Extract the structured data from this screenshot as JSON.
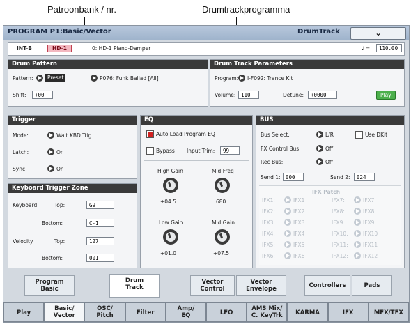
{
  "callouts": {
    "left": "Patroonbank / nr.",
    "right": "Drumtrackprogramma"
  },
  "header": {
    "title": "PROGRAM P1:Basic/Vector",
    "page": "DrumTrack",
    "menu_icon": "chevron-down-icon"
  },
  "program_bar": {
    "bank": "INT-B",
    "number": "HD-1",
    "name": "0: HD-1 Piano-Damper",
    "tempo_symbol": "♩ =",
    "tempo": "110.00"
  },
  "drum_pattern": {
    "title": "Drum Pattern",
    "pattern_label": "Pattern:",
    "pattern_source": "Preset",
    "pattern_value": "P076: Funk Ballad [All]",
    "shift_label": "Shift:",
    "shift_value": "+00"
  },
  "drum_params": {
    "title": "Drum Track Parameters",
    "program_label": "Program:",
    "program_value": "I-F092: Trance Kit",
    "volume_label": "Volume:",
    "volume_value": "110",
    "detune_label": "Detune:",
    "detune_value": "+0000",
    "play_label": "Play"
  },
  "trigger": {
    "title": "Trigger",
    "mode_label": "Mode:",
    "mode_value": "Wait KBD Trig",
    "latch_label": "Latch:",
    "latch_value": "On",
    "sync_label": "Sync:",
    "sync_value": "On"
  },
  "kbd_zone": {
    "title": "Keyboard Trigger Zone",
    "keyboard_label": "Keyboard",
    "top_label": "Top:",
    "keyboard_top": "G9",
    "bottom_label": "Bottom:",
    "keyboard_bottom": "C-1",
    "velocity_label": "Velocity",
    "velocity_top": "127",
    "velocity_bottom": "001"
  },
  "eq": {
    "title": "EQ",
    "auto_load_label": "Auto Load Program EQ",
    "bypass_label": "Bypass",
    "input_trim_label": "Input Trim:",
    "input_trim_value": "99",
    "high_gain_label": "High Gain",
    "high_gain_value": "+04.5",
    "mid_freq_label": "Mid Freq",
    "mid_freq_value": "680",
    "low_gain_label": "Low Gain",
    "low_gain_value": "+01.0",
    "mid_gain_label": "Mid Gain",
    "mid_gain_value": "+07.5"
  },
  "bus": {
    "title": "BUS",
    "bus_select_label": "Bus Select:",
    "bus_select_value": "L/R",
    "use_dkit_label": "Use DKit",
    "fx_control_label": "FX Control Bus:",
    "fx_control_value": "Off",
    "rec_bus_label": "Rec Bus:",
    "rec_bus_value": "Off",
    "send1_label": "Send 1:",
    "send1_value": "000",
    "send2_label": "Send 2:",
    "send2_value": "024",
    "ifx_patch_title": "IFX Patch",
    "ifx": [
      {
        "label": "IFX1:",
        "value": "IFX1"
      },
      {
        "label": "IFX2:",
        "value": "IFX2"
      },
      {
        "label": "IFX3:",
        "value": "IFX3"
      },
      {
        "label": "IFX4:",
        "value": "IFX4"
      },
      {
        "label": "IFX5:",
        "value": "IFX5"
      },
      {
        "label": "IFX6:",
        "value": "IFX6"
      },
      {
        "label": "IFX7:",
        "value": "IFX7"
      },
      {
        "label": "IFX8:",
        "value": "IFX8"
      },
      {
        "label": "IFX9:",
        "value": "IFX9"
      },
      {
        "label": "IFX10:",
        "value": "IFX10"
      },
      {
        "label": "IFX11:",
        "value": "IFX11"
      },
      {
        "label": "IFX12:",
        "value": "IFX12"
      }
    ]
  },
  "sub_tabs": [
    {
      "line1": "Program",
      "line2": "Basic"
    },
    {
      "line1": "Drum",
      "line2": "Track"
    },
    {
      "line1": "Vector",
      "line2": "Control"
    },
    {
      "line1": "Vector",
      "line2": "Envelope"
    },
    {
      "line1": "Controllers",
      "line2": ""
    },
    {
      "line1": "Pads",
      "line2": ""
    }
  ],
  "main_tabs": [
    {
      "line1": "Play",
      "line2": ""
    },
    {
      "line1": "Basic/",
      "line2": "Vector"
    },
    {
      "line1": "OSC/",
      "line2": "Pitch"
    },
    {
      "line1": "Filter",
      "line2": ""
    },
    {
      "line1": "Amp/",
      "line2": "EQ"
    },
    {
      "line1": "LFO",
      "line2": ""
    },
    {
      "line1": "AMS Mix/",
      "line2": "C. KeyTrk"
    },
    {
      "line1": "KARMA",
      "line2": ""
    },
    {
      "line1": "IFX",
      "line2": ""
    },
    {
      "line1": "MFX/TFX",
      "line2": ""
    }
  ]
}
